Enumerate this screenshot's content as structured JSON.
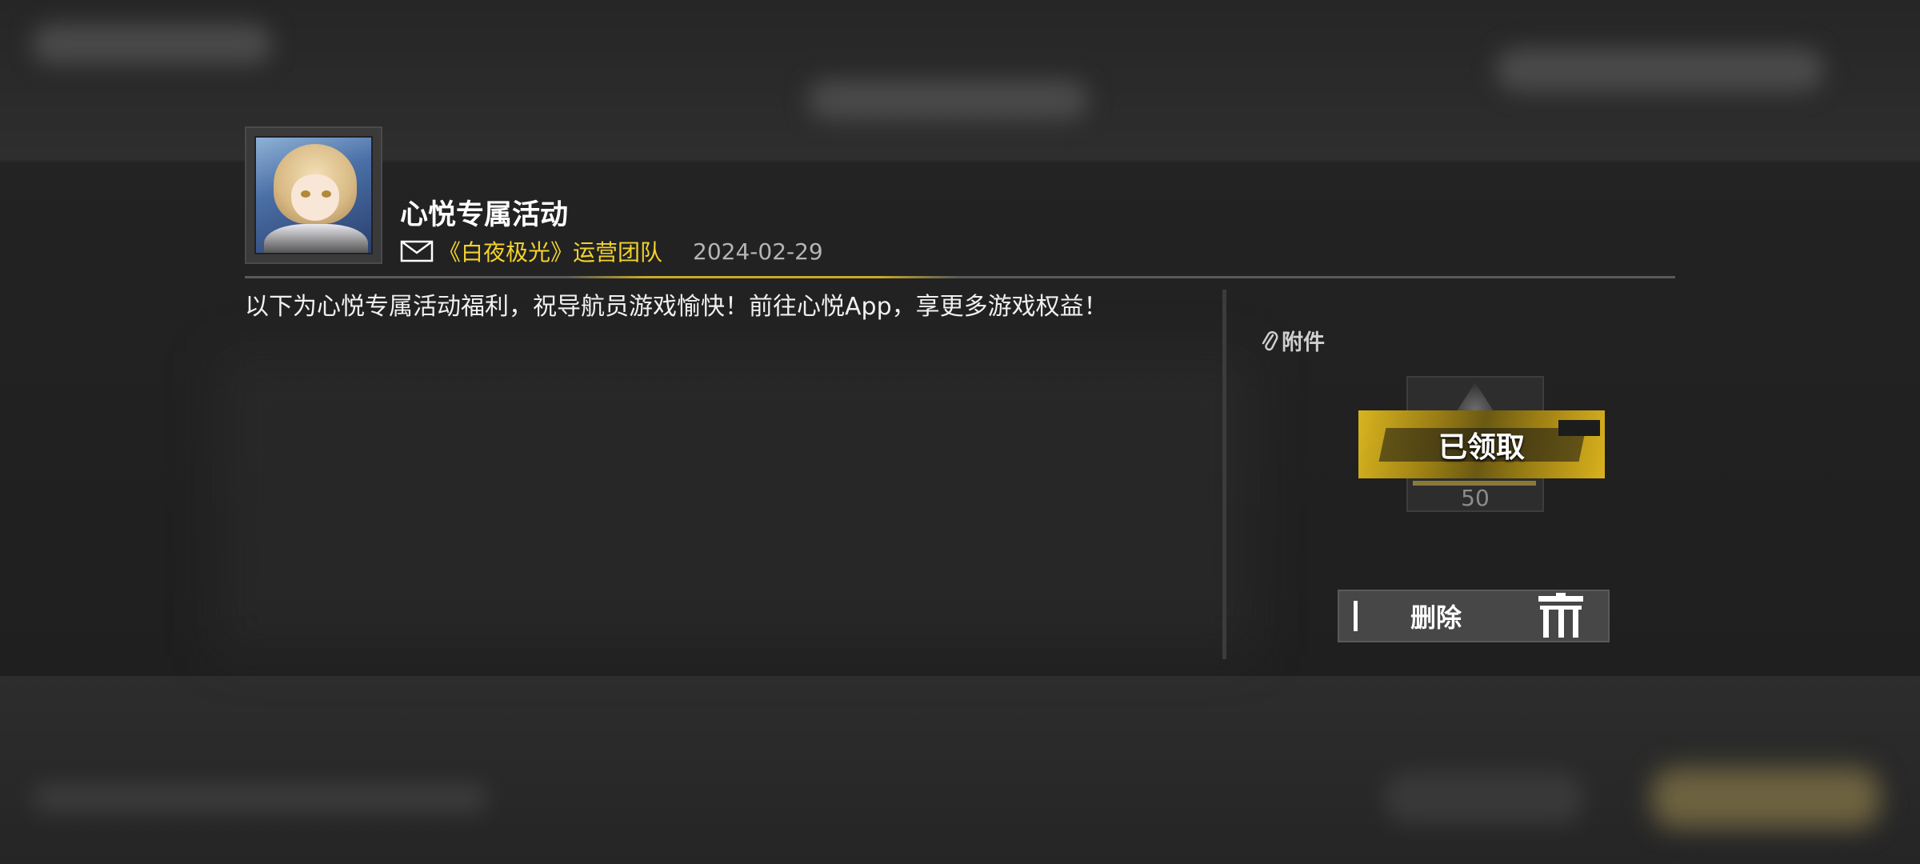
{
  "mail": {
    "title": "心悦专属活动",
    "sender": "《白夜极光》运营团队",
    "date": "2024-02-29",
    "body": "以下为心悦专属活动福利，祝导航员游戏愉快！前往心悦App，享更多游戏权益！"
  },
  "attachments": {
    "label": "附件",
    "items": [
      {
        "status": "已领取",
        "count": "50"
      }
    ]
  },
  "actions": {
    "delete_label": "删除"
  },
  "colors": {
    "accent": "#f2d22e",
    "panel": "#222222",
    "text_muted": "#b5b5b5"
  },
  "icons": [
    "mail-icon",
    "paperclip-icon",
    "trash-icon",
    "avatar"
  ]
}
